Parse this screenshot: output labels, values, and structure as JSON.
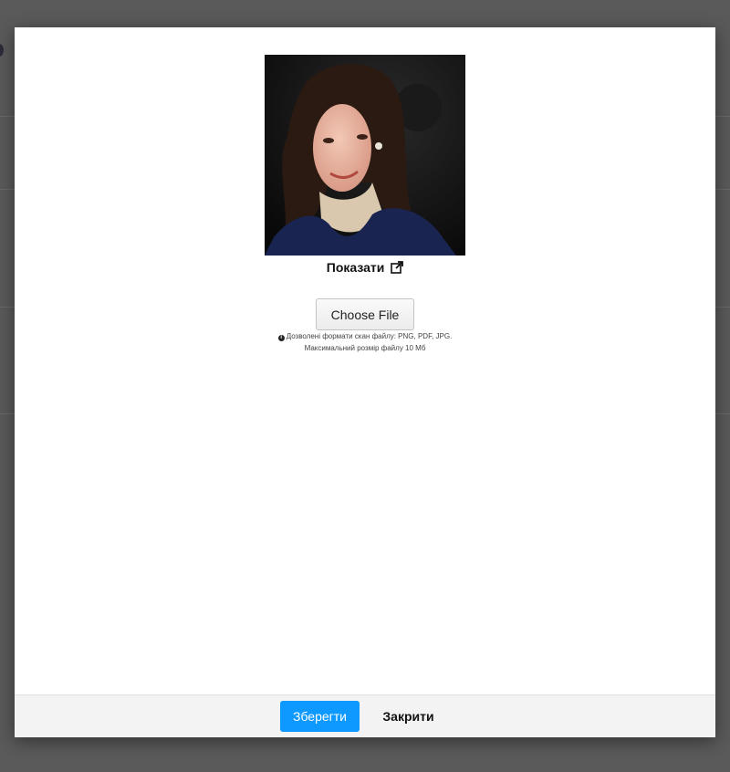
{
  "photo": {
    "alt": "profile photo"
  },
  "show_link": {
    "label": "Показати",
    "icon": "external-link-icon"
  },
  "upload": {
    "button_label": "Choose File",
    "hint_icon": "info-icon",
    "hint_formats": "Дозволені формати скан файлу: PNG, PDF, JPG.",
    "hint_size": "Максимальний розмір файлу 10 Мб"
  },
  "footer": {
    "save_label": "Зберегти",
    "close_label": "Закрити"
  },
  "colors": {
    "primary": "#0d99ff",
    "overlay": "#5a5a5a",
    "footer_bg": "#f3f3f3"
  }
}
